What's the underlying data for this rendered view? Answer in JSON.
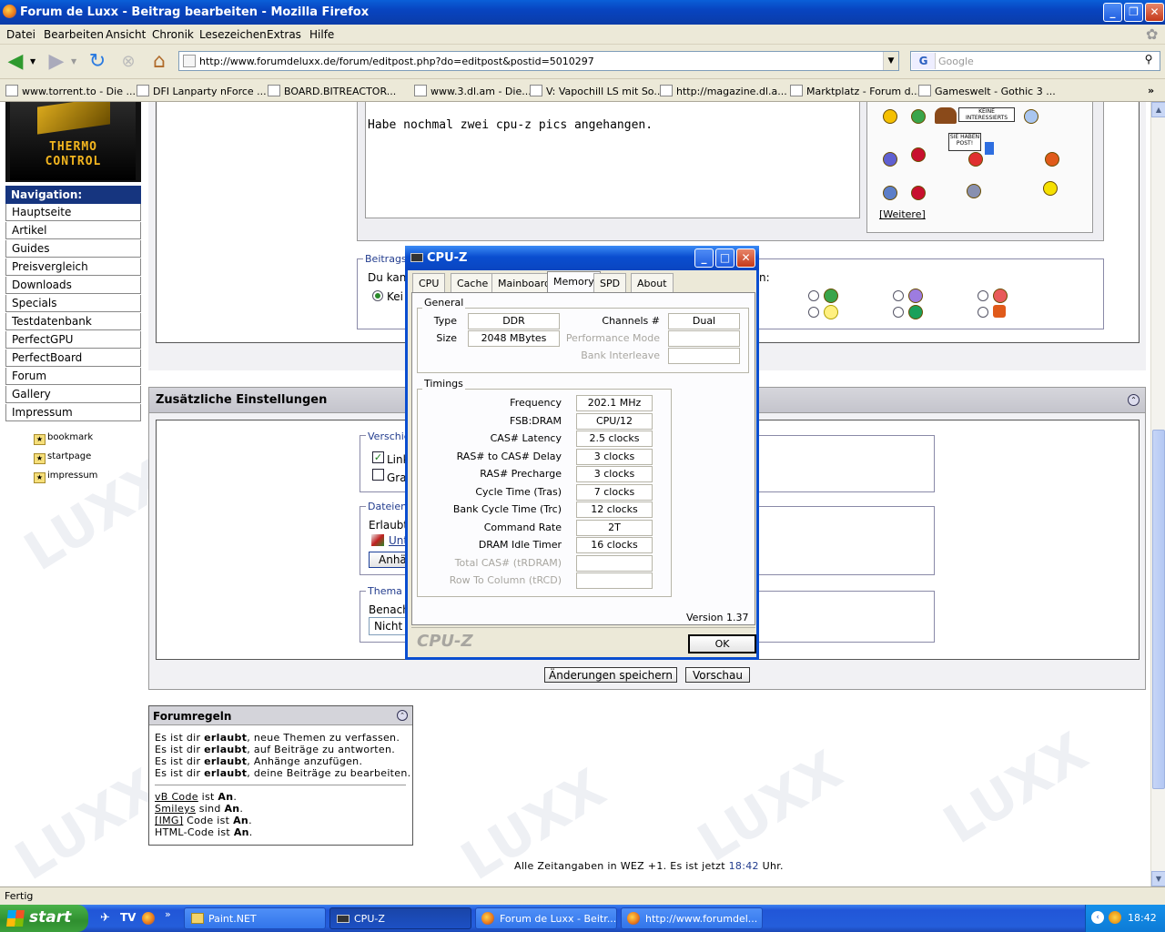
{
  "window": {
    "title": "Forum de Luxx - Beitrag bearbeiten - Mozilla Firefox"
  },
  "menu": [
    "Datei",
    "Bearbeiten",
    "Ansicht",
    "Chronik",
    "Lesezeichen",
    "Extras",
    "Hilfe"
  ],
  "url": "http://www.forumdeluxx.de/forum/editpost.php?do=editpost&postid=5010297",
  "search": {
    "engine": "G",
    "placeholder": "Google"
  },
  "bookmarks": [
    "www.torrent.to - Die ...",
    "DFI Lanparty nForce ...",
    "BOARD.BITREACTOR...",
    "www.3.dl.am - Die...",
    "V: Vapochill LS mit So...",
    "http://magazine.dl.a...",
    "Marktplatz - Forum d...",
    "Gameswelt - Gothic 3 ..."
  ],
  "sidebar": {
    "logo": [
      "THERMO",
      "CONTROL"
    ],
    "heading": "Navigation:",
    "items": [
      "Hauptseite",
      "Artikel",
      "Guides",
      "Preisvergleich",
      "Downloads",
      "Specials",
      "Testdatenbank",
      "PerfectGPU",
      "PerfectBoard",
      "Forum",
      "Gallery",
      "Impressum"
    ],
    "favorites": [
      "bookmark",
      "startpage",
      "impressum"
    ]
  },
  "editor": {
    "message": "Habe nochmal zwei cpu-z pics angehangen.",
    "smilie_more": "[Weitere]",
    "sign_texts": [
      "KEINE INTERESSIERTS",
      "SIE HABEN POST!"
    ]
  },
  "post_icons": {
    "legend": "Beitragss",
    "text": "Du kan",
    "none_label": "Kei",
    "trailing": "n:"
  },
  "additional": {
    "title": "Zusätzliche Einstellungen",
    "misc_legend": "Verschie",
    "misc_options": [
      "Link",
      "Gra"
    ],
    "files_legend": "Dateien",
    "files_text": "Erlaubt",
    "files_link": "Unt",
    "attach_button": "Anhä",
    "thread_legend": "Thema a",
    "notify_label": "Benach",
    "notify_value": "Nicht"
  },
  "buttons": {
    "save": "Änderungen speichern",
    "preview": "Vorschau"
  },
  "rules": {
    "title": "Forumregeln",
    "lines": [
      {
        "pre": "Es ist dir ",
        "bold": "erlaubt",
        "post": ", neue Themen zu verfassen."
      },
      {
        "pre": "Es ist dir ",
        "bold": "erlaubt",
        "post": ", auf Beiträge zu antworten."
      },
      {
        "pre": "Es ist dir ",
        "bold": "erlaubt",
        "post": ", Anhänge anzufügen."
      },
      {
        "pre": "Es ist dir ",
        "bold": "erlaubt",
        "post": ", deine Beiträge zu bearbeiten."
      }
    ],
    "codes": [
      {
        "link": "vB Code",
        "mid": " ist ",
        "bold": "An",
        "end": "."
      },
      {
        "link": "Smileys",
        "mid": " sind ",
        "bold": "An",
        "end": "."
      },
      {
        "link": "[IMG]",
        "mid": " Code ist ",
        "bold": "An",
        "end": "."
      },
      {
        "link": "",
        "mid": "HTML-Code ist ",
        "bold": "An",
        "end": "."
      }
    ]
  },
  "footer": {
    "pre": "Alle Zeitangaben in WEZ +1. Es ist jetzt ",
    "time": "18:42",
    "post": " Uhr."
  },
  "watermark": "LUXX",
  "cpuz": {
    "title": "CPU-Z",
    "tabs": [
      "CPU",
      "Cache",
      "Mainboard",
      "Memory",
      "SPD",
      "About"
    ],
    "active_tab": "Memory",
    "general": {
      "legend": "General",
      "type_label": "Type",
      "type": "DDR",
      "size_label": "Size",
      "size": "2048 MBytes",
      "channels_label": "Channels #",
      "channels": "Dual",
      "perf_label": "Performance Mode",
      "bank_label": "Bank Interleave"
    },
    "timings": {
      "legend": "Timings",
      "rows": [
        {
          "label": "Frequency",
          "value": "202.1 MHz"
        },
        {
          "label": "FSB:DRAM",
          "value": "CPU/12"
        },
        {
          "label": "CAS# Latency",
          "value": "2.5 clocks"
        },
        {
          "label": "RAS# to CAS# Delay",
          "value": "3 clocks"
        },
        {
          "label": "RAS# Precharge",
          "value": "3 clocks"
        },
        {
          "label": "Cycle Time (Tras)",
          "value": "7 clocks"
        },
        {
          "label": "Bank Cycle Time (Trc)",
          "value": "12 clocks"
        },
        {
          "label": "Command Rate",
          "value": "2T"
        },
        {
          "label": "DRAM Idle Timer",
          "value": "16 clocks"
        },
        {
          "label": "Total CAS# (tRDRAM)",
          "value": ""
        },
        {
          "label": "Row To Column (tRCD)",
          "value": ""
        }
      ]
    },
    "version": "Version 1.37",
    "brand": "CPU-Z",
    "ok": "OK"
  },
  "status": "Fertig",
  "taskbar": {
    "start": "start",
    "tasks": [
      "Paint.NET",
      "CPU-Z",
      "Forum de Luxx - Beitr...",
      "http://www.forumdel..."
    ],
    "clock": "18:42"
  }
}
